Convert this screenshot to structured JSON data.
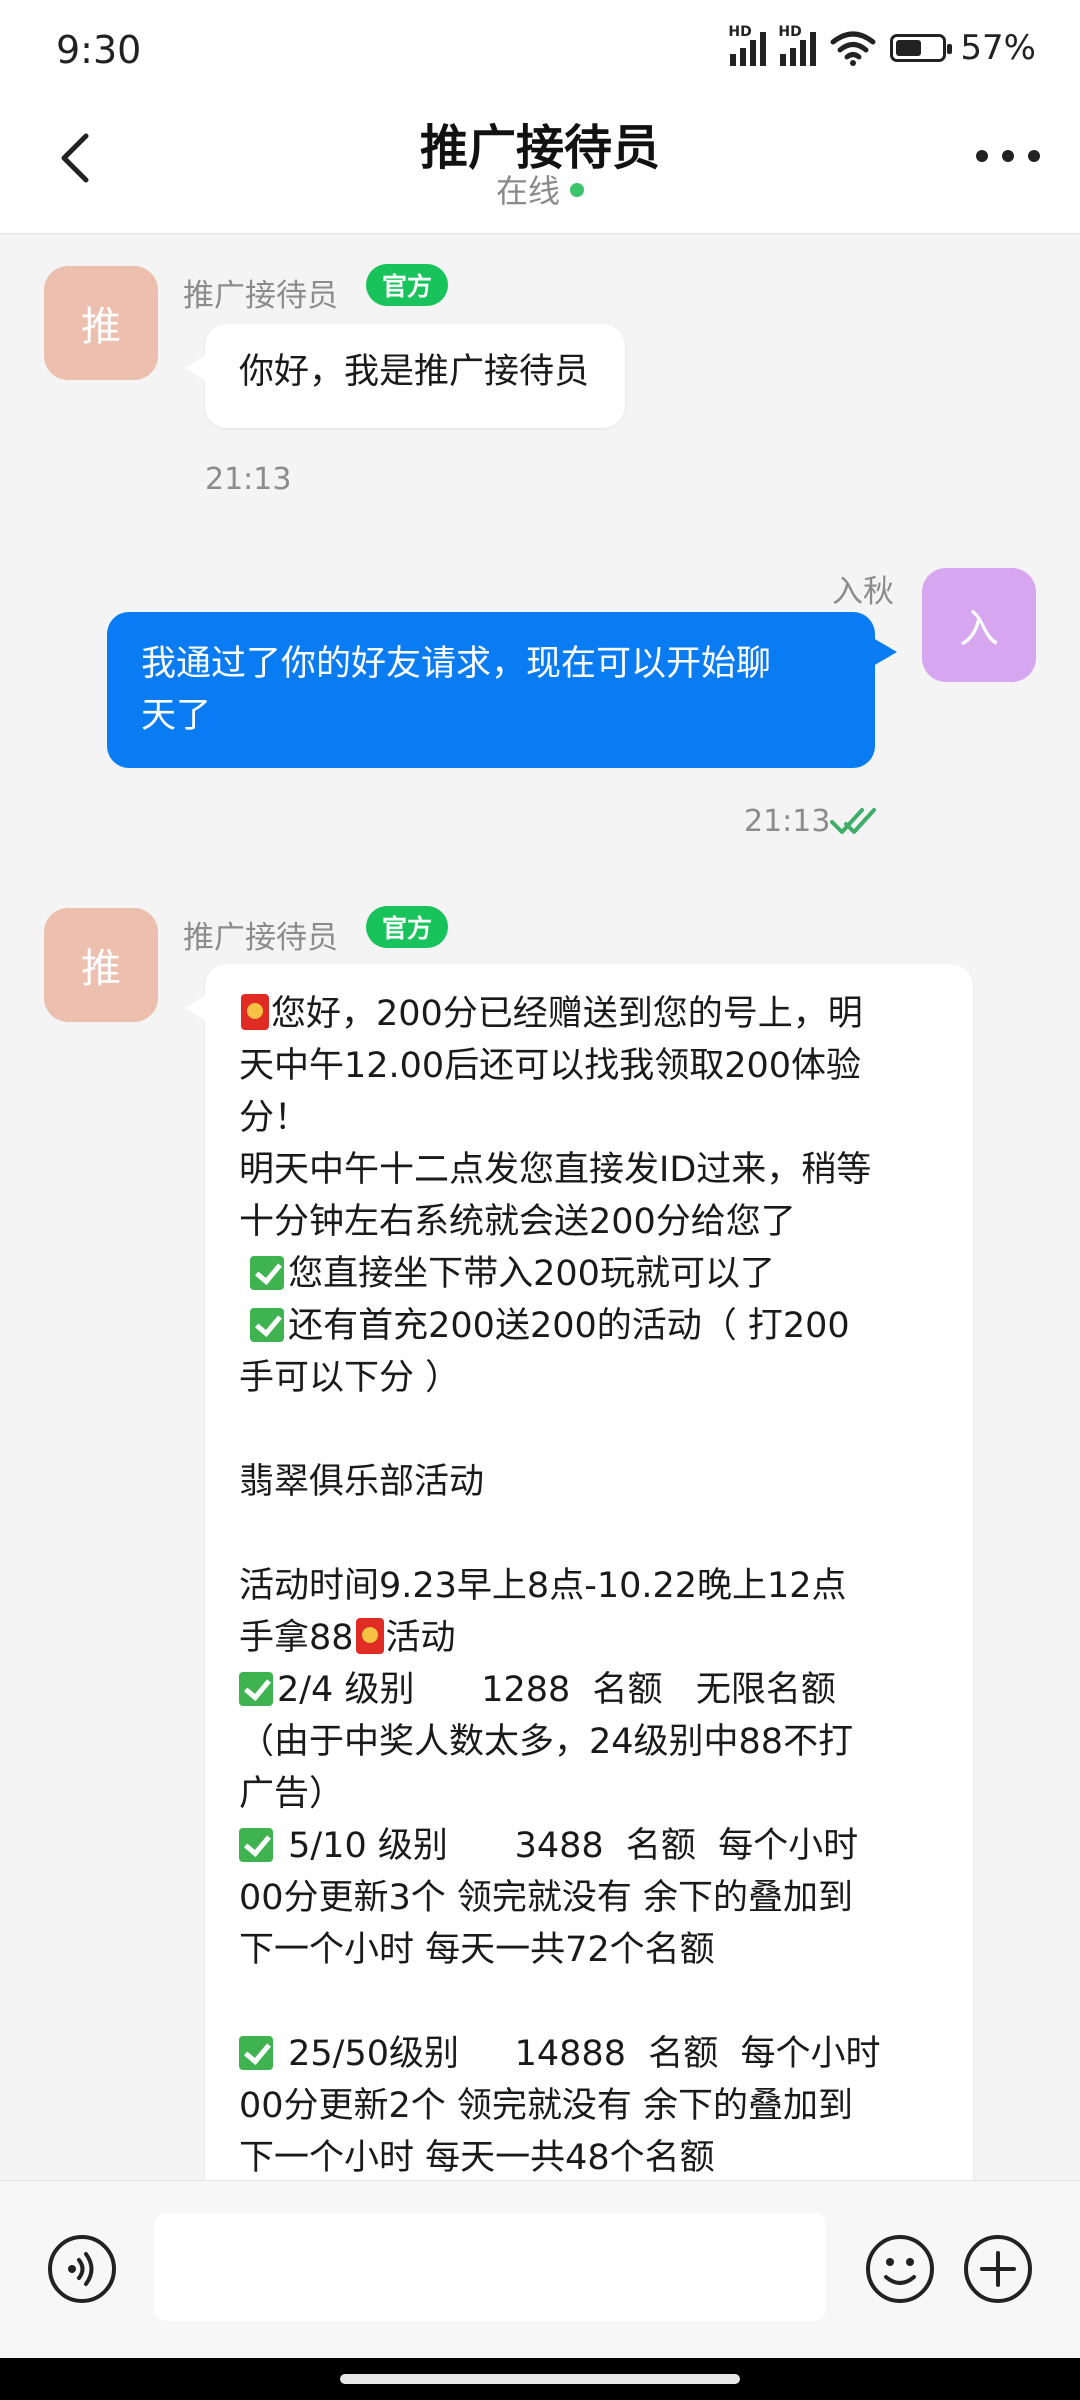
{
  "status_bar": {
    "time": "9:30",
    "network_1": "HD",
    "network_2": "HD",
    "battery_level": 0.57,
    "battery_text": "57%"
  },
  "header": {
    "title": "推广接待员",
    "status": "在线"
  },
  "messages": [
    {
      "sender": "推广接待员",
      "avatar_text": "推",
      "badge": "官方",
      "text": "你好，我是推广接待员",
      "time": "21:13"
    },
    {
      "sender": "入秋",
      "avatar_text": "入",
      "text": "我通过了你的好友请求，现在可以开始聊\n天了",
      "time": "21:13"
    },
    {
      "sender": "推广接待员",
      "avatar_text": "推",
      "badge": "官方",
      "lines": [
        "您好，200分已经赠送到您的号上，明",
        "天中午12.00后还可以找我领取200体验",
        "分！",
        "明天中午十二点发您直接发ID过来，稍等",
        "十分钟左右系统就会送200分给您了",
        "您直接坐下带入200玩就可以了",
        "还有首充200送200的活动（ 打200",
        "手可以下分 ）",
        "",
        "翡翠俱乐部活动",
        "",
        "活动时间9.23早上8点-10.22晚上12点",
        "手拿88",
        "活动",
        "2/4 级别      1288  名额   无限名额",
        "（由于中奖人数太多，24级别中88不打",
        "广告）",
        " 5/10 级别      3488  名额  每个小时",
        "00分更新3个  领完就没有 余下的叠加到",
        "下一个小时 每天一共72个名额",
        "",
        " 25/50级别     14888  名额  每个小时",
        "00分更新2个  领完就没有 余下的叠加到",
        "下一个小时 每天一共48个名额"
      ]
    }
  ],
  "icons": {
    "back": "chevron-left-icon",
    "more": "more-dots-icon",
    "voice": "voice-icon",
    "emoji": "emoji-icon",
    "plus": "plus-icon",
    "read": "double-check-icon",
    "red_packet": "red-packet-icon",
    "check": "check-box-icon"
  },
  "input": {
    "value": "",
    "placeholder": ""
  },
  "colors": {
    "accent": "#0a7cf3",
    "official_badge": "#19c35c",
    "online": "#3cc46a",
    "avatar_receiver": "#edbfae",
    "avatar_self": "#d7a6f0"
  }
}
